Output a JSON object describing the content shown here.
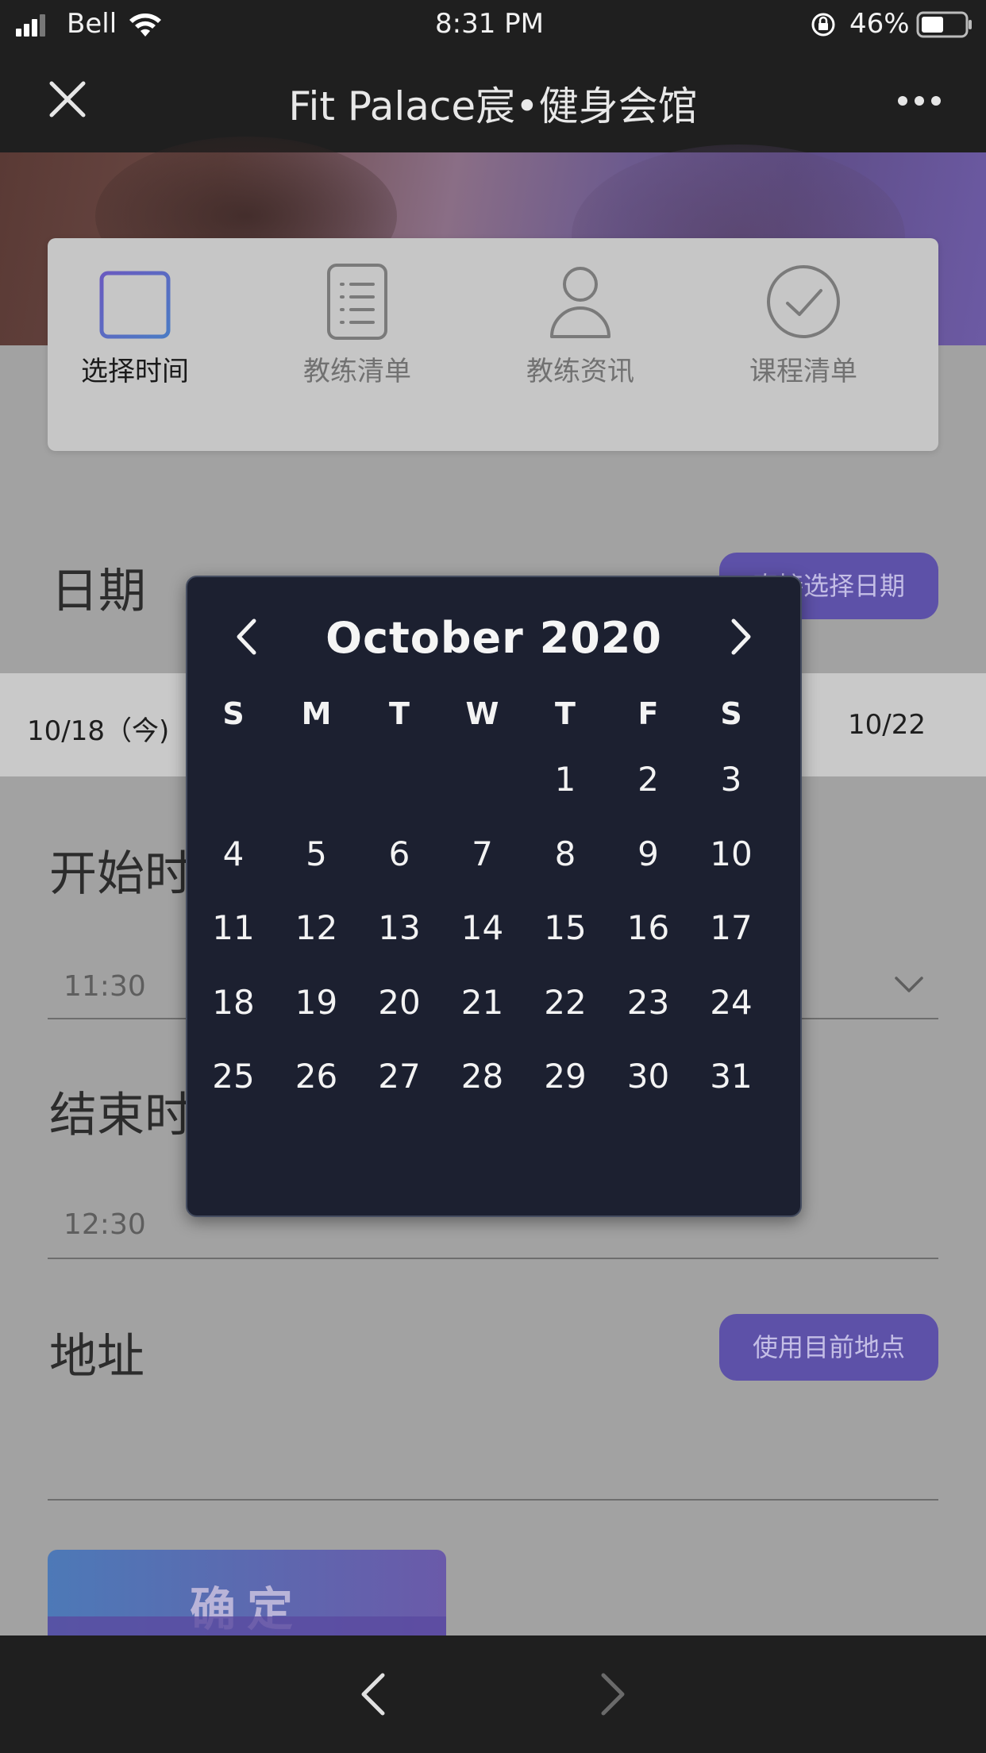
{
  "status_bar": {
    "carrier": "Bell",
    "time": "8:31 PM",
    "battery": "46%",
    "icons": [
      "signal-icon",
      "wifi-icon",
      "orientation-lock-icon",
      "battery-icon"
    ]
  },
  "nav": {
    "title": "Fit Palace宸•健身会馆",
    "close_icon": "close-icon",
    "more_icon": "more-icon"
  },
  "steps": [
    {
      "label": "选择时间",
      "icon": "calendar-icon",
      "active": true
    },
    {
      "label": "教练清单",
      "icon": "list-icon",
      "active": false
    },
    {
      "label": "教练资讯",
      "icon": "person-icon",
      "active": false
    },
    {
      "label": "课程清单",
      "icon": "check-circle-icon",
      "active": false
    }
  ],
  "date_section": {
    "title": "日期",
    "button": "直接选择日期",
    "dates": [
      "10/18（今)",
      "10/22"
    ]
  },
  "start_time": {
    "title": "开始时间",
    "value": "11:30"
  },
  "end_time": {
    "title": "结束时间",
    "value": "12:30"
  },
  "address": {
    "title": "地址",
    "button": "使用目前地点"
  },
  "confirm_label": "确定",
  "calendar": {
    "month_title": "October 2020",
    "weekdays": [
      "S",
      "M",
      "T",
      "W",
      "T",
      "F",
      "S"
    ],
    "first_weekday_index": 4,
    "days_in_month": 31,
    "prev_icon": "chevron-left-icon",
    "next_icon": "chevron-right-icon"
  },
  "browser_bar": {
    "back_icon": "back-icon",
    "forward_icon": "forward-icon"
  }
}
